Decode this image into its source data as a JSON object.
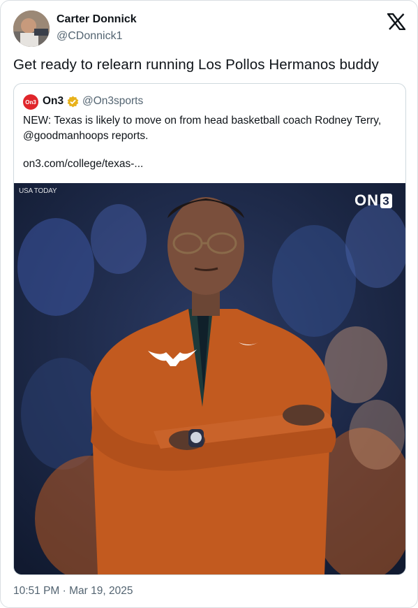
{
  "tweet": {
    "author_name": "Carter Donnick",
    "author_handle": "@CDonnick1",
    "text": "Get ready to relearn running Los Pollos Hermanos buddy",
    "timestamp": "10:51 PM · Mar 19, 2025",
    "platform_icon": "x-logo-icon",
    "avatar_icon": "user-avatar"
  },
  "quoted": {
    "logo_text": "On3",
    "name": "On3",
    "handle": "@On3sports",
    "verified_icon": "verified-gold-badge-icon",
    "text": "NEW: Texas is likely to move on from head basketball coach Rodney Terry, @goodmanhoops reports.",
    "link": "on3.com/college/texas-...",
    "image": {
      "credit": "USA TODAY",
      "watermark_prefix": "ON",
      "watermark_digit": "3"
    }
  },
  "colors": {
    "accent_red": "#e0262b",
    "jacket_orange": "#c25a1f",
    "verified_gold": "#e8b21b",
    "muted_text": "#536471"
  }
}
